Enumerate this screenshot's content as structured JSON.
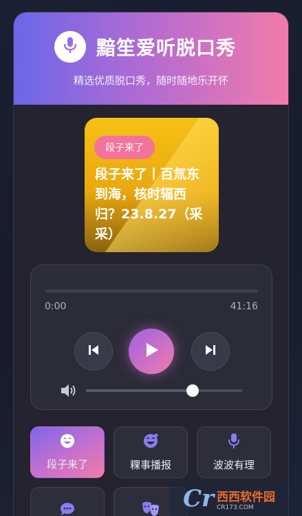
{
  "header": {
    "title": "黯笙爱听脱口秀",
    "subtitle": "精选优质脱口秀，随时随地乐开怀",
    "logo_icon": "microphone-icon"
  },
  "now_playing": {
    "tag": "段子来了",
    "title": "段子来了丨百氚东到海，核时辐西归？23.8.27（采采）"
  },
  "player": {
    "current_time": "0:00",
    "total_time": "41:16",
    "progress": 0.0,
    "volume": 0.68,
    "prev_icon": "skip-previous-icon",
    "play_icon": "play-icon",
    "next_icon": "skip-next-icon",
    "volume_icon": "volume-icon"
  },
  "categories": [
    {
      "label": "段子来了",
      "icon": "smile-icon",
      "active": true
    },
    {
      "label": "粿事播报",
      "icon": "laugh-icon",
      "active": false
    },
    {
      "label": "波波有理",
      "icon": "microphone-icon",
      "active": false
    },
    {
      "label": "",
      "icon": "chat-bubble-icon",
      "active": false
    },
    {
      "label": "",
      "icon": "theater-masks-icon",
      "active": false
    }
  ],
  "watermark": {
    "text": "西西软件园",
    "sub": "CR173.COM"
  },
  "colors": {
    "header_start": "#6c67e9",
    "header_end": "#f27bab",
    "tag": "#f3739d",
    "accent_purple": "#9f62e4",
    "accent_pink": "#f07bab"
  }
}
